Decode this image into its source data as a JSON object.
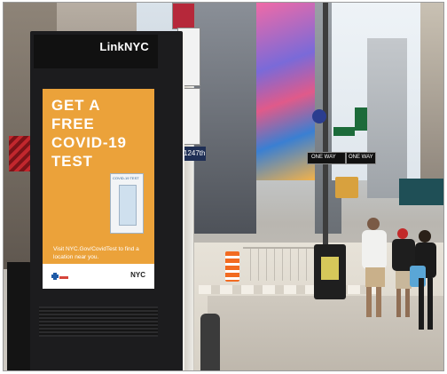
{
  "kiosk": {
    "brand": "LinkNYC",
    "screen": {
      "title_lines": [
        "GET A",
        "FREE",
        "COVID-19",
        "TEST"
      ],
      "kit_label": "COVID-19 TEST",
      "footer_text": "Visit NYC.Gov/CovidTest to find a location near you.",
      "footer_logo": "NYC"
    }
  },
  "signs": {
    "address_number": "1247th",
    "street_sign": "",
    "one_way_left": "ONE WAY",
    "one_way_right": "ONE WAY"
  },
  "colors": {
    "screen_orange": "#eba23a",
    "kiosk_black": "#1c1c1e",
    "barrel_orange": "#f26b21",
    "street_sign_green": "#1c6b3a"
  }
}
